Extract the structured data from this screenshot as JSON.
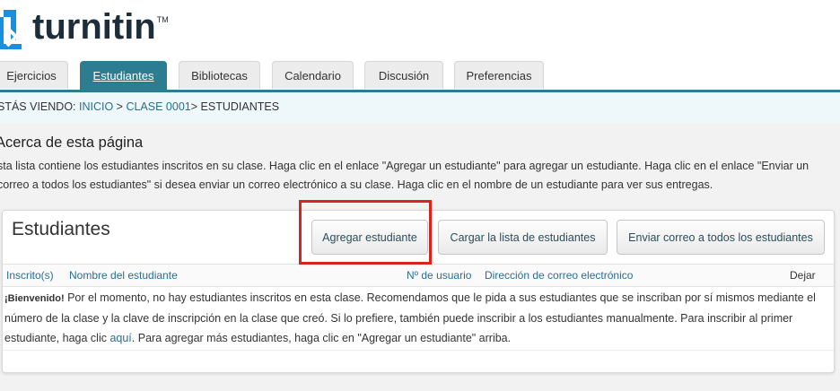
{
  "logo": {
    "text": "turnitin",
    "tm": "TM"
  },
  "tabs": [
    {
      "label": "Ejercicios"
    },
    {
      "label": "Estudiantes"
    },
    {
      "label": "Bibliotecas"
    },
    {
      "label": "Calendario"
    },
    {
      "label": "Discusión"
    },
    {
      "label": "Preferencias"
    }
  ],
  "breadcrumb": {
    "prefix": "STÁS VIENDO: ",
    "home": "INICIO",
    "sep1": " > ",
    "class": "CLASE 0001",
    "sep2": "> ",
    "current": "ESTUDIANTES"
  },
  "about": {
    "title": "Acerca de esta página",
    "text": "sta lista contiene los estudiantes inscritos en su clase. Haga clic en el enlace \"Agregar un estudiante\" para agregar un estudiante. Haga clic en el enlace \"Enviar un correo a todos los estudiantes\" si desea enviar un correo electrónico a su clase. Haga clic en el nombre de un estudiante para ver sus entregas."
  },
  "panel": {
    "title": "Estudiantes",
    "buttons": {
      "add": "Agregar estudiante",
      "upload": "Cargar la lista de estudiantes",
      "email_all": "Enviar correo a todos los estudiantes"
    },
    "columns": {
      "enrolled": "Inscrito(s)",
      "name": "Nombre del estudiante",
      "user_id": "Nº de usuario",
      "email": "Dirección de correo electrónico",
      "drop": "Dejar"
    },
    "message": {
      "welcome": "¡Bienvenido!",
      "part1": " Por el momento, no hay estudiantes inscritos en esta clase. Recomendamos que le pida a sus estudiantes que se inscriban por sí mismos mediante el número de la clase y la clave de inscripción en la clase que creó. Si lo prefiere, también puede inscribir a los estudiantes manualmente. Para inscribir al primer estudiante, haga clic ",
      "link": "aquí",
      "part2": ". Para agregar más estudiantes, haga clic en \"Agregar un estudiante\" arriba."
    }
  },
  "colors": {
    "accent": "#2c7c92",
    "logo_blue": "#1a8fe0",
    "highlight": "#d9231f"
  }
}
